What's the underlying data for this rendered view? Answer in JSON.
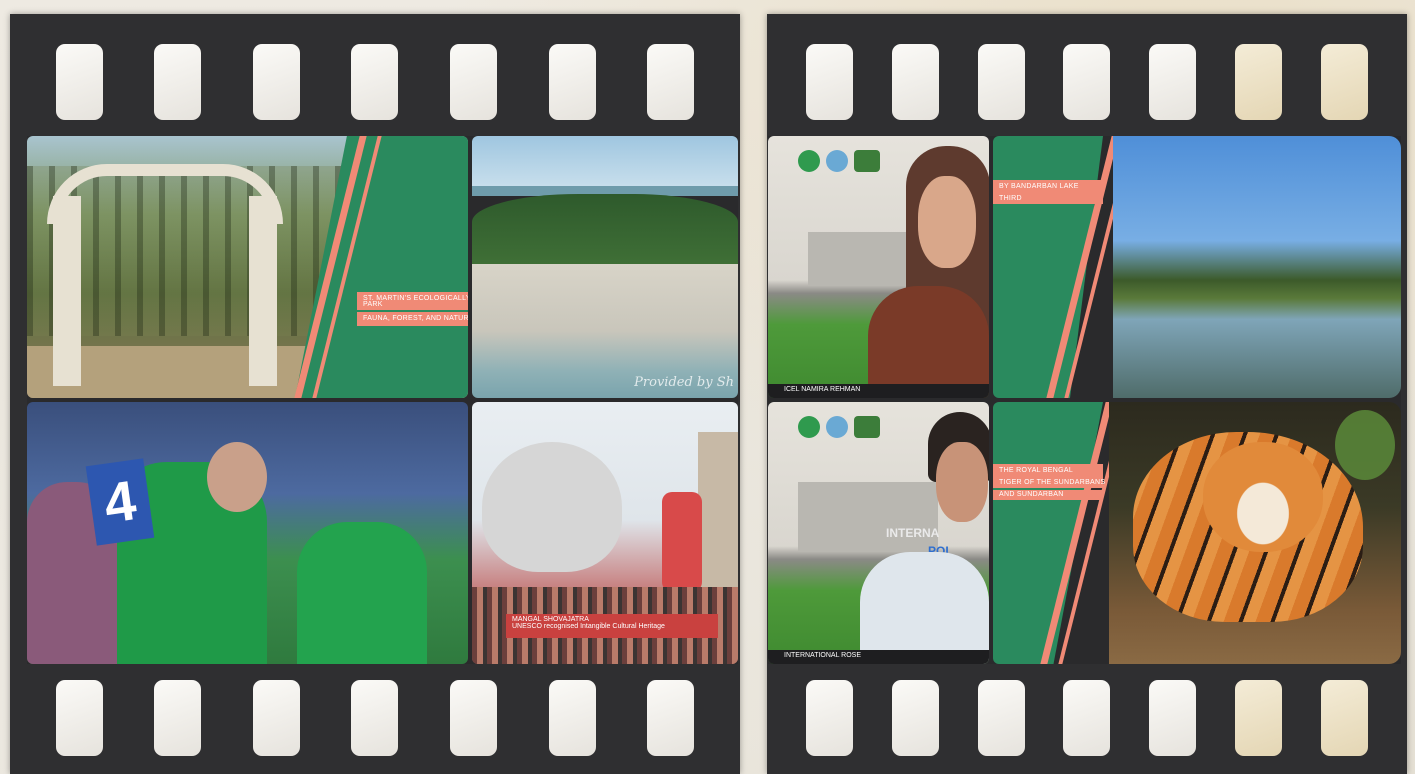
{
  "frames": {
    "park": {
      "tag_line1": "ST. MARTIN'S ECOLOGICALLY",
      "tag_line2": "PARK",
      "tag_line3": "FAUNA, FOREST, AND NATURE"
    },
    "beach": {
      "watermark": "Provided by Sh"
    },
    "speaker1": {
      "name_bar": "ICEL NAMIRA REHMAN"
    },
    "lake": {
      "tag_line1": "BY BANDARBAN LAKE",
      "tag_line2": "THIRD"
    },
    "celebration": {
      "banner": "4"
    },
    "festival": {
      "caption_line1": "MANGAL SHOVAJATRA",
      "caption_line2": "UNESCO recognised Intangible Cultural Heritage"
    },
    "speaker2": {
      "name_bar": "INTERNATIONAL ROSE",
      "sign": "INTERNA",
      "sign2": "POI"
    },
    "tiger": {
      "tag_line1": "THE ROYAL BENGAL",
      "tag_line2": "TIGER OF THE SUNDARBANS",
      "tag_line3": "AND SUNDARBAN"
    }
  },
  "colors": {
    "green": "#2a8a5e",
    "salmon": "#f08a76",
    "film": "#2f2f31"
  }
}
